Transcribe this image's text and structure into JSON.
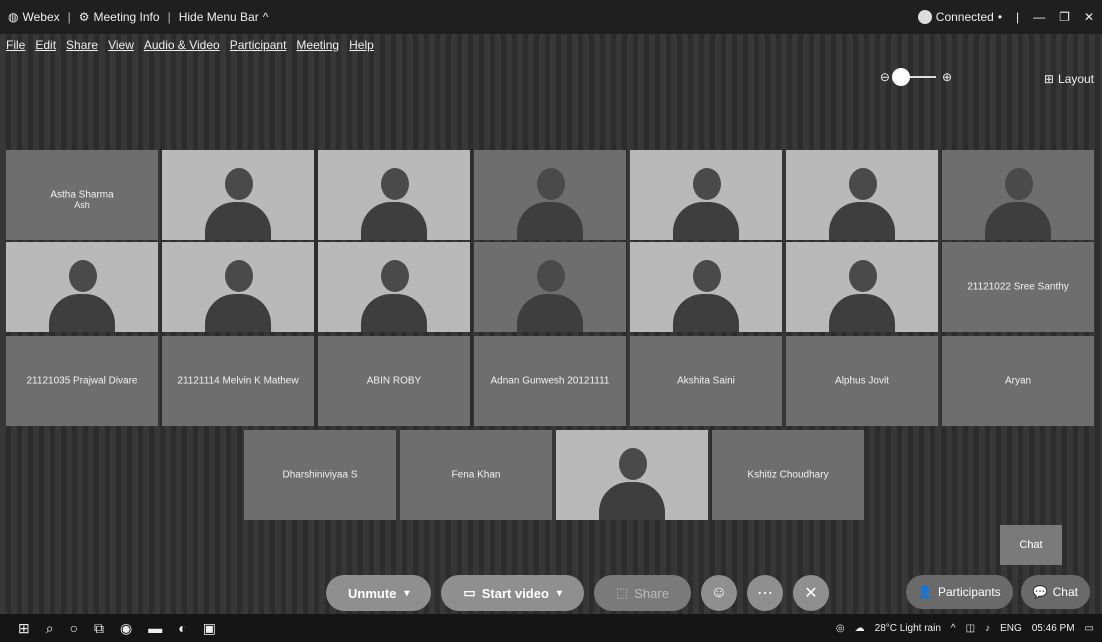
{
  "titlebar": {
    "app": "Webex",
    "meeting_info": "Meeting Info",
    "hide_menu_bar": "Hide Menu Bar",
    "connected": "Connected"
  },
  "menu": [
    "File",
    "Edit",
    "Share",
    "View",
    "Audio & Video",
    "Participant",
    "Meeting",
    "Help"
  ],
  "layout_label": "Layout",
  "rows": [
    [
      {
        "name": "Astha Sharma",
        "sub": "Ash",
        "video": false
      },
      {
        "name": "",
        "video": true
      },
      {
        "name": "",
        "video": true
      },
      {
        "name": "",
        "video": true
      },
      {
        "name": "",
        "video": true
      },
      {
        "name": "",
        "video": true
      },
      {
        "name": "",
        "video": true
      }
    ],
    [
      {
        "name": "",
        "video": true
      },
      {
        "name": "",
        "video": true
      },
      {
        "name": "",
        "video": true
      },
      {
        "name": "",
        "video": true
      },
      {
        "name": "",
        "video": true
      },
      {
        "name": "",
        "video": true
      },
      {
        "name": "21121022 Sree Santhy",
        "video": false
      }
    ],
    [
      {
        "name": "21121035 Prajwal Divare",
        "video": false
      },
      {
        "name": "21121114 Melvin K Mathew",
        "video": false
      },
      {
        "name": "ABIN ROBY",
        "video": false
      },
      {
        "name": "Adnan Gunwesh 20121111",
        "video": false
      },
      {
        "name": "Akshita Saini",
        "video": false
      },
      {
        "name": "Alphus Jovit",
        "video": false
      },
      {
        "name": "Aryan",
        "video": false
      }
    ],
    [
      {
        "name": "Dharshiniviyaa S",
        "video": false
      },
      {
        "name": "Fena Khan",
        "video": false
      },
      {
        "name": "",
        "video": true
      },
      {
        "name": "Kshitiz Choudhary",
        "video": false
      }
    ]
  ],
  "controls": {
    "unmute": "Unmute",
    "start_video": "Start video",
    "share": "Share",
    "participants": "Participants",
    "chat": "Chat",
    "chat_bubble": "Chat"
  },
  "taskbar": {
    "weather": "28°C Light rain",
    "lang": "ENG",
    "time": "05:46 PM"
  }
}
